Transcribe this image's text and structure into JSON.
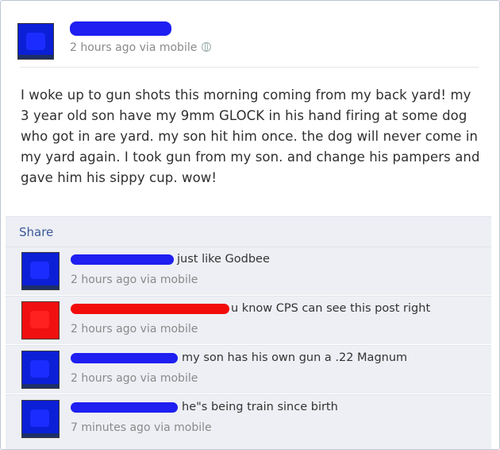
{
  "post": {
    "meta": "2 hours ago via mobile",
    "privacy_icon": "globe-icon",
    "text": "I woke up to gun shots this morning coming from my back yard! my 3 year old son have my 9mm GLOCK in his hand firing at some dog who got in are yard. my son hit him once. the dog will never come in my yard again. I took gun from my son. and change his pampers and gave him his sippy cup. wow!"
  },
  "actions": {
    "share": "Share"
  },
  "comments": [
    {
      "text": "just like Godbee",
      "meta": "2 hours ago via mobile"
    },
    {
      "text": "u know CPS can see this post right",
      "meta": "2 hours ago via mobile"
    },
    {
      "text": "my son has his own gun a .22 Magnum",
      "meta": "2 hours ago via mobile"
    },
    {
      "text": "he\"s being train since birth",
      "meta": "7 minutes ago via mobile"
    }
  ],
  "colors": {
    "redaction_blue": "#1e1ff0",
    "redaction_red": "#f20c0c",
    "link": "#3b5998"
  }
}
